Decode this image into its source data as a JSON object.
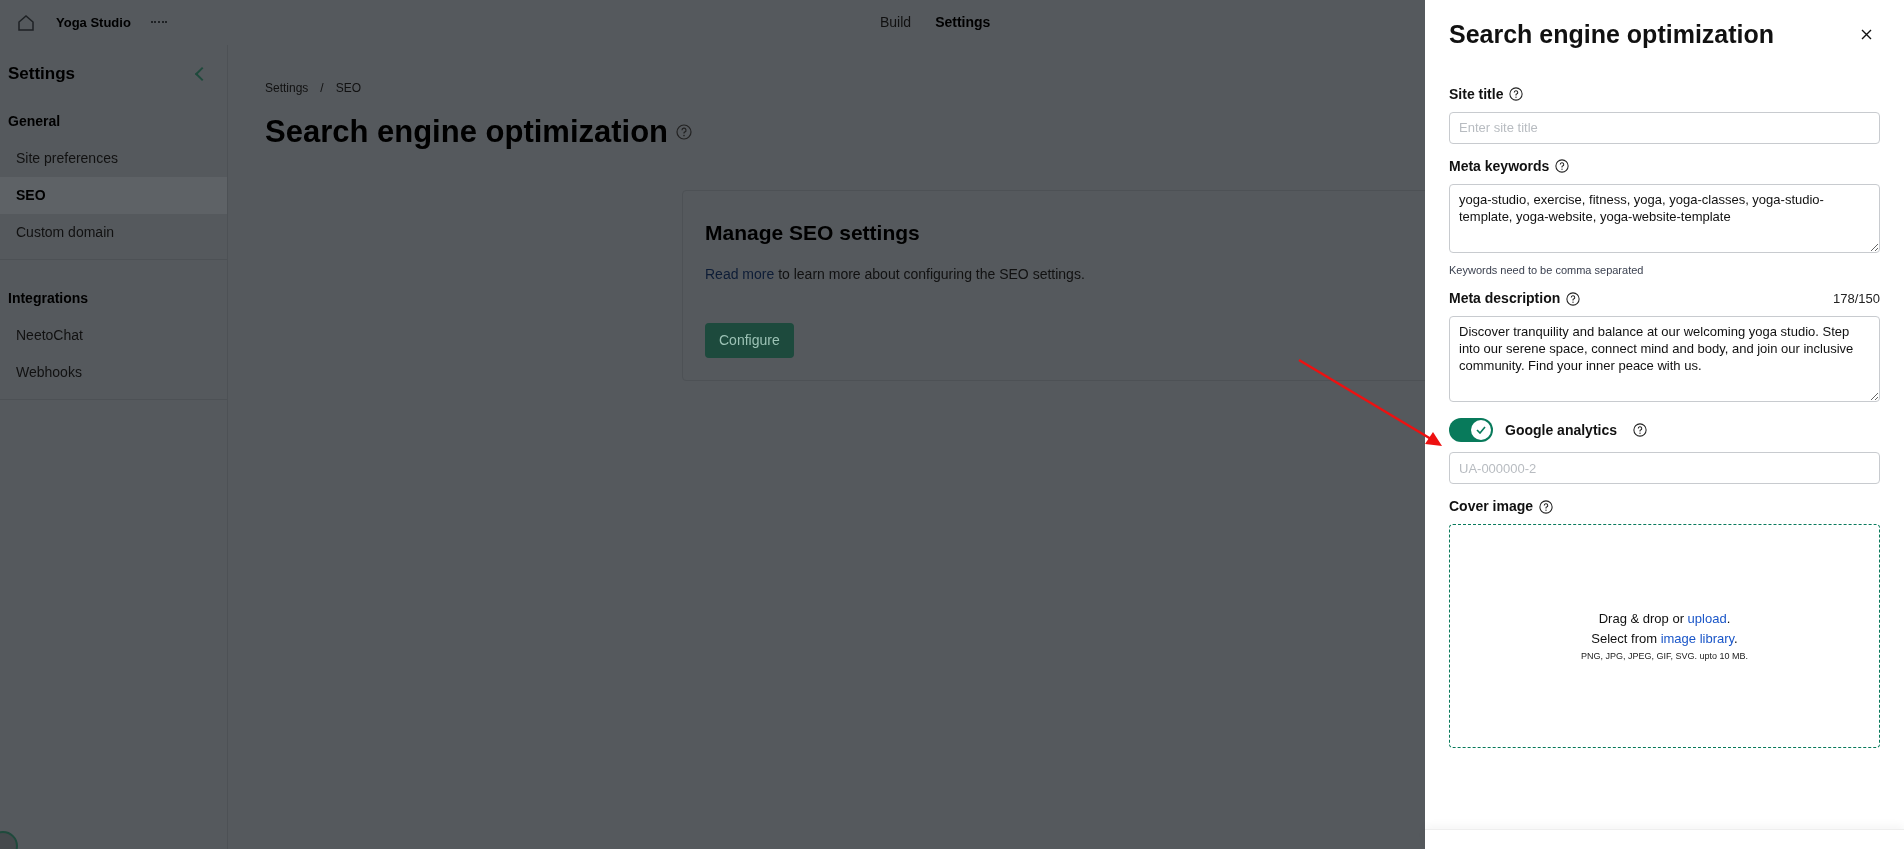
{
  "app_header": {
    "site_name": "Yoga Studio",
    "tabs": [
      {
        "label": "Build",
        "selected": false
      },
      {
        "label": "Settings",
        "selected": true
      }
    ]
  },
  "sidebar": {
    "title": "Settings",
    "sections": [
      {
        "heading": "General",
        "items": [
          {
            "label": "Site preferences",
            "selected": false
          },
          {
            "label": "SEO",
            "selected": true
          },
          {
            "label": "Custom domain",
            "selected": false
          }
        ]
      },
      {
        "heading": "Integrations",
        "items": [
          {
            "label": "NeetoChat",
            "selected": false
          },
          {
            "label": "Webhooks",
            "selected": false
          }
        ]
      }
    ]
  },
  "main": {
    "breadcrumbs": [
      "Settings",
      "SEO"
    ],
    "breadcrumb_separator": "/",
    "title": "Search engine optimization",
    "card": {
      "heading": "Manage SEO settings",
      "link": "Read more",
      "text": " to learn more about configuring the SEO settings.",
      "button": "Configure"
    }
  },
  "panel": {
    "title": "Search engine optimization",
    "fields": [
      {
        "kind": "text",
        "label": "Site title",
        "placeholder": "Enter site title"
      },
      {
        "kind": "textarea",
        "label": "Meta keywords",
        "value": "yoga-studio, exercise, fitness, yoga, yoga-classes, yoga-studio-template, yoga-website, yoga-website-template",
        "hint": "Keywords need to be comma separated"
      },
      {
        "kind": "textarea",
        "label": "Meta description",
        "counter": "178/150",
        "value": "Discover tranquility and balance at our welcoming yoga studio. Step into our serene space, connect mind and body, and join our inclusive community. Find your inner peace with us."
      },
      {
        "kind": "toggle",
        "label": "Google analytics",
        "on": true
      },
      {
        "kind": "text",
        "placeholder": "UA-000000-2"
      },
      {
        "kind": "dropzone",
        "label": "Cover image",
        "line1": "Drag & drop or ",
        "line1_link": "upload",
        "line1_end": ".",
        "line2": "Select from ",
        "line2_link": "image library",
        "line2_end": ".",
        "formats": "PNG, JPG, JPEG, GIF, SVG. upto 10 MB."
      }
    ]
  }
}
